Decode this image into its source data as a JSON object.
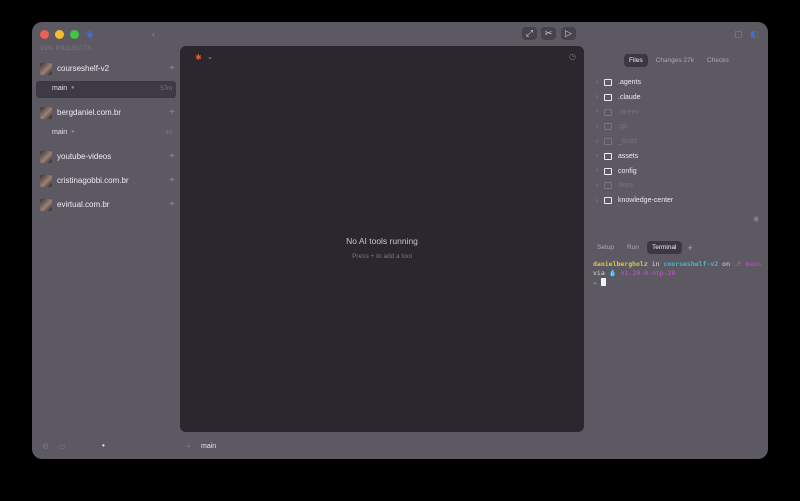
{
  "titlebar": {
    "back_icon": "back-arrow-icon",
    "actions": [
      {
        "name": "open-external-button",
        "glyph": "⤢"
      },
      {
        "name": "scissors-button",
        "glyph": "✂"
      },
      {
        "name": "play-button",
        "glyph": "▷"
      }
    ]
  },
  "sidebar": {
    "heading": "93% PROJECTS",
    "projects": [
      {
        "name": "courseshelf-v2",
        "branches": [
          {
            "name": "main",
            "meta": "57m",
            "active": true
          }
        ]
      },
      {
        "name": "bergdaniel.com.br",
        "branches": [
          {
            "name": "main",
            "meta": "4d",
            "active": false
          }
        ]
      },
      {
        "name": "youtube-videos",
        "branches": []
      },
      {
        "name": "cristinagobbi.com.br",
        "branches": []
      },
      {
        "name": "evirtual.com.br",
        "branches": []
      }
    ]
  },
  "main": {
    "empty_title": "No AI tools running",
    "empty_subtitle": "Press + to add a tool",
    "footer_branch": "main"
  },
  "right_panel": {
    "tabs": [
      {
        "label": "Files",
        "active": true
      },
      {
        "label": "Changes 27k",
        "active": false
      },
      {
        "label": "Checks",
        "active": false
      }
    ],
    "files": [
      {
        "name": ".agents",
        "dim": false
      },
      {
        "name": ".claude",
        "dim": false
      },
      {
        "name": ".direnv",
        "dim": true
      },
      {
        "name": ".git",
        "dim": true
      },
      {
        "name": "_build",
        "dim": true
      },
      {
        "name": "assets",
        "dim": false
      },
      {
        "name": "config",
        "dim": false
      },
      {
        "name": "deps",
        "dim": true
      },
      {
        "name": "knowledge-center",
        "dim": false
      }
    ],
    "terminal_tabs": [
      {
        "label": "Setup",
        "active": false
      },
      {
        "label": "Run",
        "active": false
      },
      {
        "label": "Terminal",
        "active": true
      }
    ],
    "terminal": {
      "user": "danielbergholz",
      "in": " in ",
      "dir": "courseshelf-v2",
      "on": " on ",
      "branch": " main",
      "via": "via ",
      "version": " v1.20.0-otp-28",
      "prompt": "→"
    }
  }
}
